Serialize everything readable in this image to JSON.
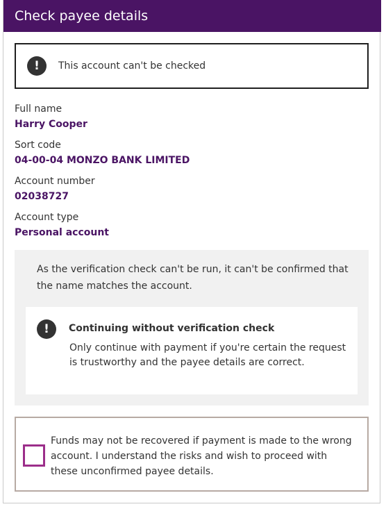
{
  "header": {
    "title": "Check payee details"
  },
  "warning": {
    "icon": "exclamation-circle-icon",
    "text": "This account can't be checked"
  },
  "fields": [
    {
      "label": "Full name",
      "value": "Harry Cooper"
    },
    {
      "label": "Sort code",
      "value": "04-00-04 MONZO BANK LIMITED"
    },
    {
      "label": "Account number",
      "value": "02038727"
    },
    {
      "label": "Account type",
      "value": "Personal account"
    }
  ],
  "info": {
    "text": "As the verification check can't be run, it can't be confirmed that the name matches the account.",
    "alert_icon": "exclamation-circle-icon",
    "alert_title": "Continuing without verification check",
    "alert_body": "Only continue with payment if you're certain the request is trustworthy and the payee details are correct."
  },
  "consent": {
    "checked": false,
    "text": "Funds may not be recovered if payment is made to the wrong account. I understand the risks and wish to proceed with these unconfirmed payee details."
  },
  "colors": {
    "brand": "#4a1464",
    "checkbox_border": "#9c2e8a",
    "panel_bg": "#f1f1f1"
  }
}
